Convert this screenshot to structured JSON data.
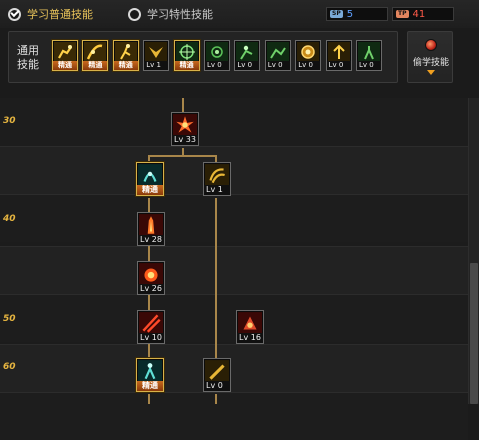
{
  "header": {
    "tab_normal": "学习普通技能",
    "tab_special": "学习特性技能",
    "sp_blue": {
      "tag": "SP",
      "value": "5"
    },
    "sp_red": {
      "tag": "TP",
      "value": "41"
    }
  },
  "common_skills": {
    "label": "通用技能",
    "mastered_label": "精通",
    "items": [
      {
        "name": "common-skill-1",
        "status": "精通",
        "icon": "crouch-figure-icon"
      },
      {
        "name": "common-skill-2",
        "status": "精通",
        "icon": "slash-figure-icon"
      },
      {
        "name": "common-skill-3",
        "status": "精通",
        "icon": "run-figure-icon"
      },
      {
        "name": "common-skill-4",
        "status": "Lv 1",
        "icon": "wings-icon"
      },
      {
        "name": "common-skill-5",
        "status": "精通",
        "icon": "crosshair-icon"
      },
      {
        "name": "common-skill-6",
        "status": "Lv 0",
        "icon": "green-target-icon"
      },
      {
        "name": "common-skill-7",
        "status": "Lv 0",
        "icon": "cast-figure-icon"
      },
      {
        "name": "common-skill-8",
        "status": "Lv 0",
        "icon": "leap-figure-icon"
      },
      {
        "name": "common-skill-9",
        "status": "Lv 0",
        "icon": "golden-orb-icon"
      },
      {
        "name": "common-skill-10",
        "status": "Lv 0",
        "icon": "rise-figure-icon"
      },
      {
        "name": "common-skill-11",
        "status": "Lv 0",
        "icon": "green-figure-icon"
      }
    ]
  },
  "steal_skill": {
    "label": "偷学技能"
  },
  "tree": {
    "levels": [
      "30",
      "40",
      "50",
      "60"
    ],
    "skills": [
      {
        "id": "s30",
        "status": "Lv 33",
        "icon": "fire-burst-icon"
      },
      {
        "id": "s35a",
        "status": "精通",
        "icon": "dark-aura-icon"
      },
      {
        "id": "s35b",
        "status": "Lv 1",
        "icon": "golden-wave-icon"
      },
      {
        "id": "s40",
        "status": "Lv 28",
        "icon": "fire-pillar-icon"
      },
      {
        "id": "s45",
        "status": "Lv 26",
        "icon": "explosion-icon"
      },
      {
        "id": "s50a",
        "status": "Lv 10",
        "icon": "red-slash-icon"
      },
      {
        "id": "s50b",
        "status": "Lv 16",
        "icon": "red-burst-icon"
      },
      {
        "id": "s60a",
        "status": "精通",
        "icon": "teal-figure-icon"
      },
      {
        "id": "s60b",
        "status": "Lv 0",
        "icon": "gold-blade-icon"
      }
    ]
  },
  "colors": {
    "accent_gold": "#e6b540",
    "connector": "#a8864a",
    "mastered_bg": "#c86a1e"
  }
}
